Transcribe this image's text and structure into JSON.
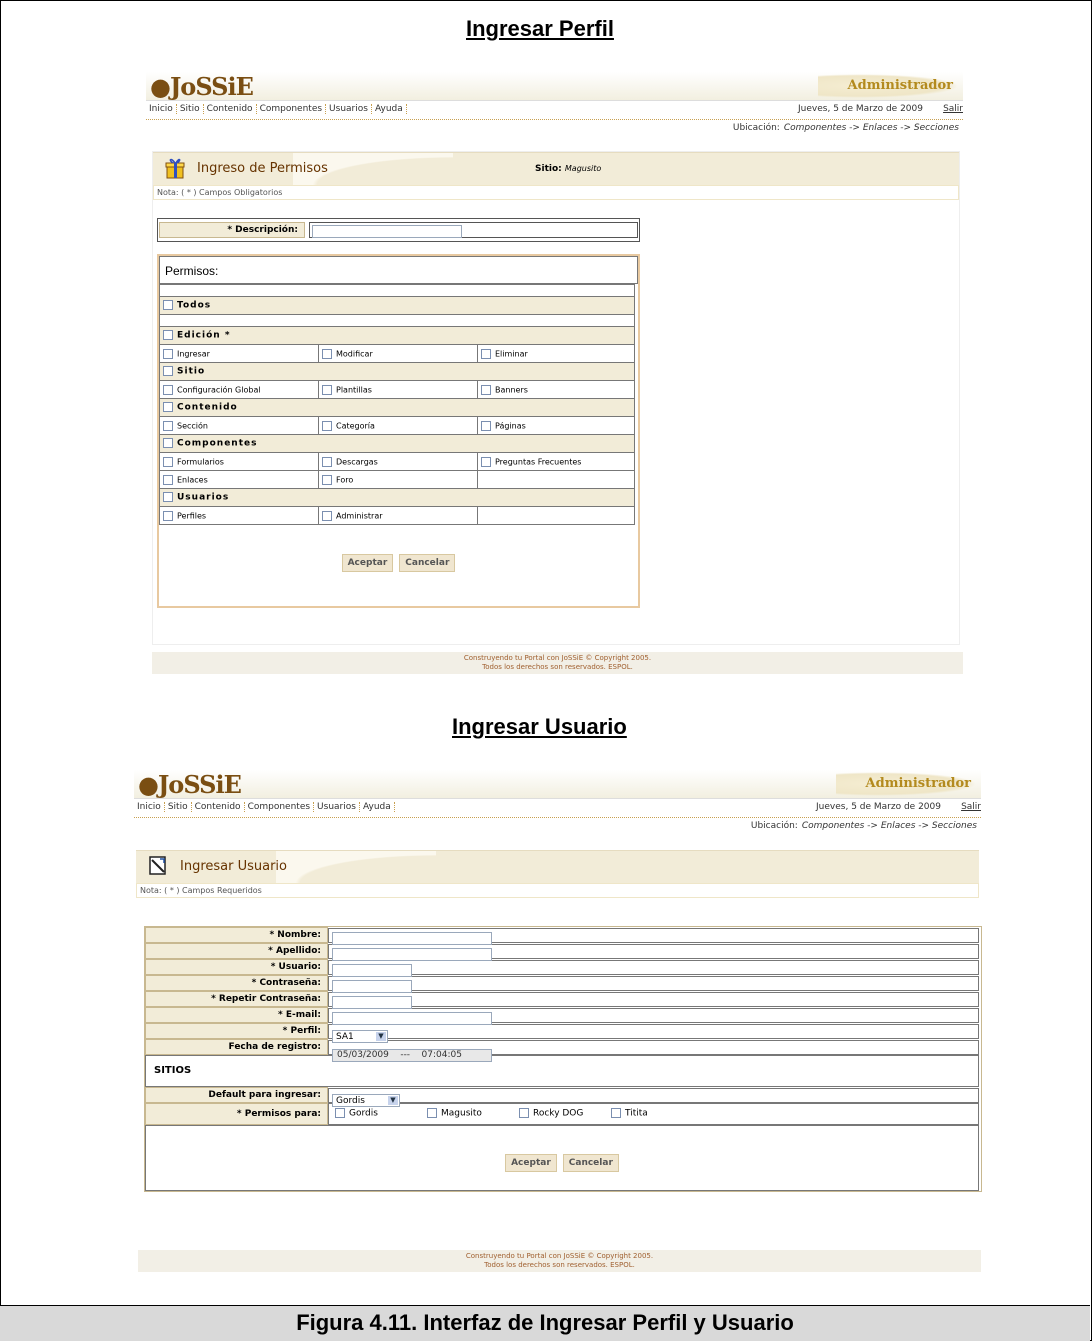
{
  "title_perfil": "Ingresar Perfil",
  "title_usuario": "Ingresar Usuario",
  "caption": "Figura 4.11. Interfaz de Ingresar Perfil y Usuario",
  "common": {
    "logo": "JoSSiE",
    "admin_label": "Administrador",
    "nav": [
      "Inicio",
      "Sitio",
      "Contenido",
      "Componentes",
      "Usuarios",
      "Ayuda"
    ],
    "date": "Jueves, 5 de Marzo de 2009",
    "salir": "Salir",
    "ubicacion_label": "Ubicación:",
    "ubicacion_path": "Componentes -> Enlaces -> Secciones",
    "footer_line1": "Construyendo tu Portal con JoSSiE © Copyright 2005.",
    "footer_line2": "Todos los derechos son reservados. ESPOL.",
    "accept": "Aceptar",
    "cancel": "Cancelar"
  },
  "perfil": {
    "box_title": "Ingreso de Permisos",
    "sitio_label": "Sitio:",
    "sitio_value": "Magusito",
    "nota": "Nota: ( * ) Campos Obligatorios",
    "descripcion_label": "* Descripción:",
    "permisos_title": "Permisos:",
    "groups": {
      "todos": "Todos",
      "edicion": "Edición *",
      "sitio": "Sitio",
      "contenido": "Contenido",
      "componentes": "Componentes",
      "usuarios": "Usuarios"
    },
    "items": {
      "ingresar": "Ingresar",
      "modificar": "Modificar",
      "eliminar": "Eliminar",
      "config_global": "Configuración Global",
      "plantillas": "Plantillas",
      "banners": "Banners",
      "seccion": "Sección",
      "categoria": "Categoría",
      "paginas": "Páginas",
      "formularios": "Formularios",
      "descargas": "Descargas",
      "preguntas": "Preguntas Frecuentes",
      "enlaces": "Enlaces",
      "foro": "Foro",
      "perfiles": "Perfiles",
      "administrar": "Administrar"
    }
  },
  "usuario": {
    "box_title": "Ingresar Usuario",
    "nota": "Nota: ( * ) Campos Requeridos",
    "nombre": "* Nombre:",
    "apellido": "* Apellido:",
    "usuario": "* Usuario:",
    "contrasena": "* Contraseña:",
    "repetir": "* Repetir Contraseña:",
    "email": "* E-mail:",
    "perfil": "* Perfil:",
    "perfil_value": "SA1",
    "fecha_label": "Fecha de registro:",
    "fecha_value": "05/03/2009    ---    07:04:05",
    "sitios_title": "SITIOS",
    "default_label": "Default para ingresar:",
    "default_value": "Gordis",
    "permisos_label": "* Permisos para:",
    "sitios": [
      "Gordis",
      "Magusito",
      "Rocky DOG",
      "Titita"
    ]
  }
}
